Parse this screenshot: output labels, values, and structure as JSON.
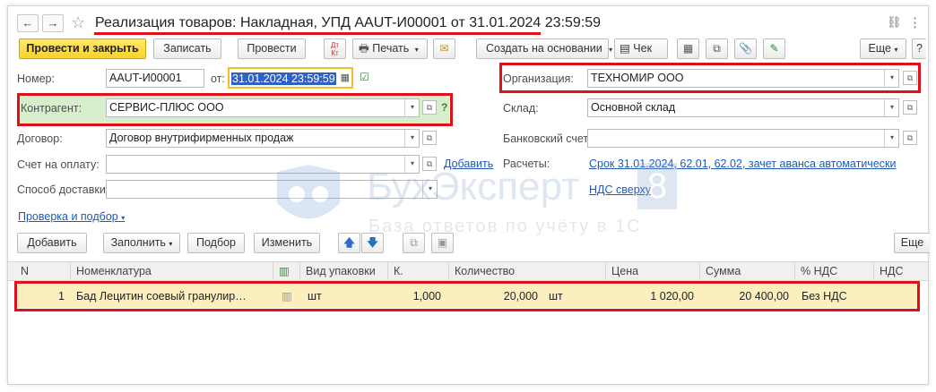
{
  "window": {
    "title": "Реализация товаров: Накладная, УПД AAUT-И00001 от 31.01.2024 23:59:59",
    "nav_back": "←",
    "nav_forward": "→",
    "star": "☆",
    "link_icon": "🔗",
    "menu_icon": "⋮",
    "close_icon": "×"
  },
  "toolbar": {
    "post_close": "Провести и закрыть",
    "save": "Записать",
    "post": "Провести",
    "dtkt": "Дт Кт",
    "print": "Печать",
    "create_based": "Создать на основании",
    "cheque": "Чек",
    "more": "Еще",
    "help": "?"
  },
  "form": {
    "number_label": "Номер:",
    "number_value": "AAUT-И00001",
    "date_from_label": "от:",
    "date_value": "31.01.2024 23:59:59",
    "org_label": "Организация:",
    "org_value": "ТЕХНОМИР ООО",
    "contractor_label": "Контрагент:",
    "contractor_value": "СЕРВИС-ПЛЮС ООО",
    "warehouse_label": "Склад:",
    "warehouse_value": "Основной склад",
    "contract_label": "Договор:",
    "contract_value": "Договор внутрифирменных продаж",
    "bank_label": "Банковский счет:",
    "bank_value": "",
    "invoice_label": "Счет на оплату:",
    "invoice_value": "",
    "add_link": "Добавить",
    "settlements_label": "Расчеты:",
    "settlements_link": "Срок 31.01.2024, 62.01, 62.02, зачет аванса автоматически",
    "delivery_label": "Способ доставки:",
    "delivery_value": "",
    "vat_link": "НДС сверху",
    "check_link": "Проверка и подбор",
    "question": "?"
  },
  "table_toolbar": {
    "add": "Добавить",
    "fill": "Заполнить",
    "pick": "Подбор",
    "change": "Изменить",
    "more": "Еще"
  },
  "table": {
    "headers": [
      "N",
      "Номенклатура",
      "Вид упаковки",
      "К.",
      "Количество",
      "Цена",
      "Сумма",
      "% НДС",
      "НДС"
    ],
    "rows": [
      {
        "n": "1",
        "item": "Бад Лецитин соевый гранулир…",
        "pack": "шт",
        "k": "1,000",
        "qty": "20,000",
        "unit": "шт",
        "price": "1 020,00",
        "sum": "20 400,00",
        "vat_rate": "Без НДС",
        "vat": ""
      }
    ]
  },
  "watermark": {
    "brand": "БухЭксперт",
    "digit": "8",
    "tagline": "База ответов по учёту в 1С"
  },
  "colors": {
    "primary_button": "#f8d22c",
    "highlight_red": "#e0101a",
    "selected_row": "#fbefbe",
    "link": "#1e59b4",
    "contractor_bg": "#d7eecd"
  }
}
